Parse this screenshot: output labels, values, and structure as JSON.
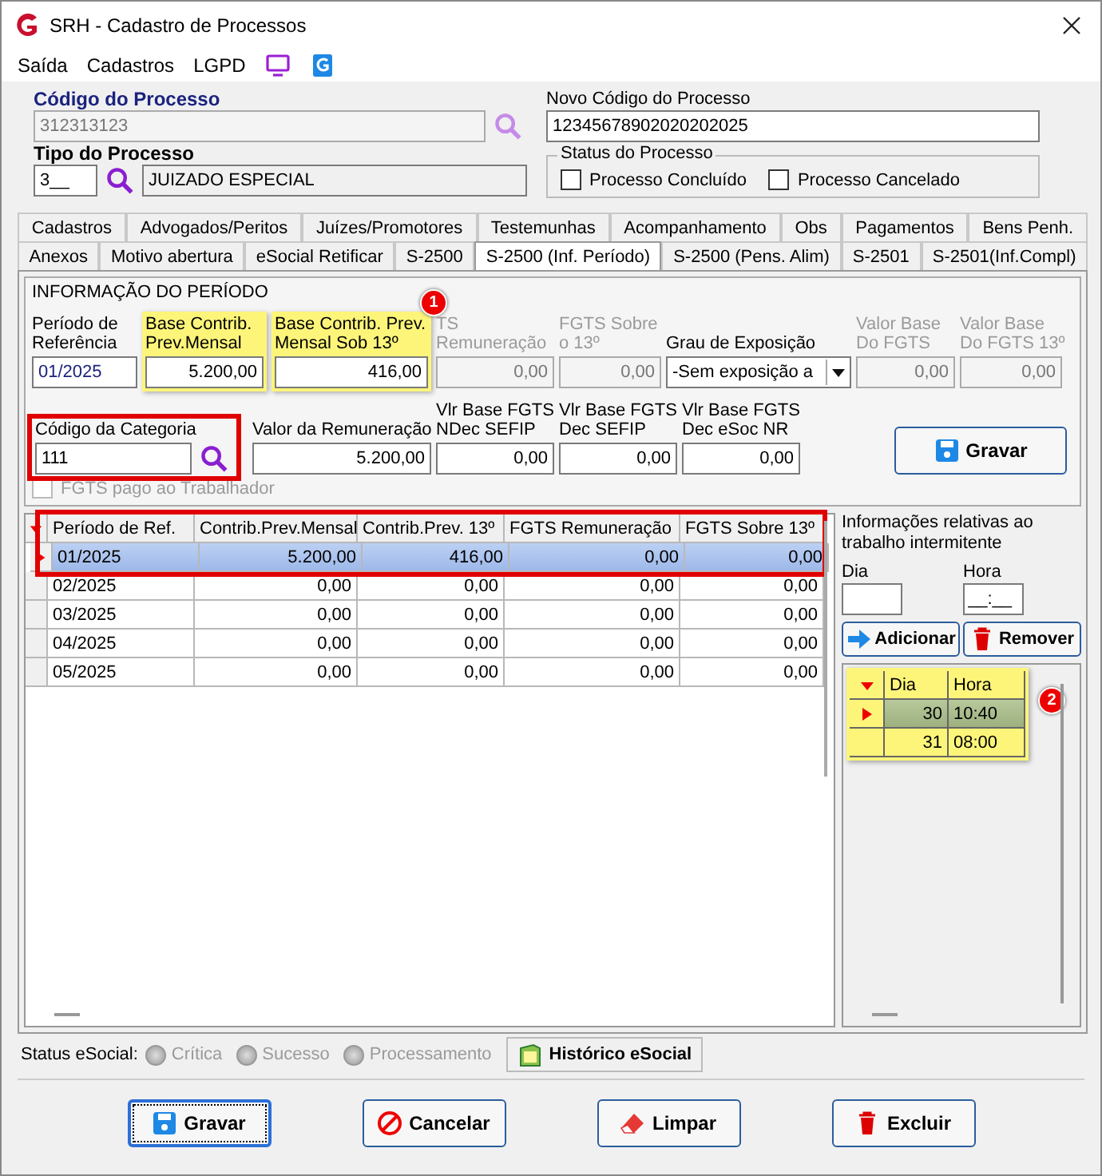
{
  "window": {
    "title": "SRH - Cadastro de Processos"
  },
  "menu": [
    {
      "label": "Saída"
    },
    {
      "label": "Cadastros"
    },
    {
      "label": "LGPD"
    }
  ],
  "process_code": {
    "label": "Código do Processo",
    "value": "312313123",
    "disabled": true
  },
  "new_process_code": {
    "label": "Novo Código do Processo",
    "value": "12345678902020202025"
  },
  "process_type": {
    "label": "Tipo do Processo",
    "code": "3__",
    "description": "JUIZADO ESPECIAL"
  },
  "process_status": {
    "title": "Status do Processo",
    "options": [
      {
        "label": "Processo Concluído",
        "checked": false
      },
      {
        "label": "Processo Cancelado",
        "checked": false
      }
    ]
  },
  "tabs_row_1": [
    {
      "label": "Cadastros",
      "selected": false
    },
    {
      "label": "Advogados/Peritos",
      "selected": false
    },
    {
      "label": "Juízes/Promotores",
      "selected": false
    },
    {
      "label": "Testemunhas",
      "selected": false
    },
    {
      "label": "Acompanhamento",
      "selected": false
    },
    {
      "label": "Obs",
      "selected": false
    },
    {
      "label": "Pagamentos",
      "selected": false
    },
    {
      "label": "Bens Penh.",
      "selected": false
    }
  ],
  "tabs_row_2": [
    {
      "label": "Anexos",
      "selected": false
    },
    {
      "label": "Motivo abertura",
      "selected": false
    },
    {
      "label": "eSocial Retificar",
      "selected": false
    },
    {
      "label": "S-2500",
      "selected": false
    },
    {
      "label": "S-2500 (Inf. Período)",
      "selected": true
    },
    {
      "label": "S-2500 (Pens. Alim)",
      "selected": false
    },
    {
      "label": "S-2501",
      "selected": false
    },
    {
      "label": "S-2501(Inf.Compl)",
      "selected": false
    }
  ],
  "period_info": {
    "title": "INFORMAÇÃO DO PERÍODO",
    "fields_row_1": [
      {
        "label": "Período de\nReferência",
        "value": "01/2025",
        "kind": "text",
        "disabled": false,
        "highlighted": false
      },
      {
        "label": "Base Contrib.\nPrev.Mensal",
        "value": "5.200,00",
        "kind": "text",
        "disabled": false,
        "highlighted": true
      },
      {
        "label": "Base Contrib. Prev.\nMensal Sob 13º",
        "value": "416,00",
        "kind": "text",
        "disabled": false,
        "highlighted": true,
        "badge": "1"
      },
      {
        "label": "TS\nRemuneração",
        "value": "0,00",
        "kind": "text",
        "disabled": true,
        "highlighted": false
      },
      {
        "label": "FGTS Sobre\no 13º",
        "value": "0,00",
        "kind": "text",
        "disabled": true,
        "highlighted": false
      },
      {
        "label": "Grau de Exposição",
        "value": "-Sem exposição a",
        "kind": "select",
        "disabled": false,
        "highlighted": false
      },
      {
        "label": "Valor Base\nDo FGTS",
        "value": "0,00",
        "kind": "text",
        "disabled": true,
        "highlighted": false
      },
      {
        "label": "Valor Base\nDo FGTS 13º",
        "value": "0,00",
        "kind": "text",
        "disabled": true,
        "highlighted": false
      }
    ],
    "fields_row_2": [
      {
        "label": "Código da Categoria",
        "value": "111",
        "kind": "search",
        "outlined": true
      },
      {
        "label": "Valor da Remuneração",
        "value": "5.200,00",
        "kind": "text",
        "outlined": false
      },
      {
        "label": "Vlr Base FGTS\nNDec SEFIP",
        "value": "0,00",
        "kind": "text",
        "outlined": false
      },
      {
        "label": "Vlr Base FGTS\nDec SEFIP",
        "value": "0,00",
        "kind": "text",
        "outlined": false
      },
      {
        "label": "Vlr Base FGTS\nDec eSoc NR",
        "value": "0,00",
        "kind": "text",
        "outlined": false
      }
    ],
    "save_button": {
      "label": "Gravar"
    },
    "fgts_paid": {
      "label": "FGTS pago ao Trabalhador",
      "checked": false,
      "disabled": true
    }
  },
  "periods_table": {
    "outlined": true,
    "columns": [
      "Período de Ref.",
      "Contrib.Prev.Mensal",
      "Contrib.Prev. 13º",
      "FGTS Remuneração",
      "FGTS Sobre 13º"
    ],
    "rows": [
      {
        "cells": [
          "01/2025",
          "5.200,00",
          "416,00",
          "0,00",
          "0,00"
        ],
        "selected": true
      },
      {
        "cells": [
          "02/2025",
          "0,00",
          "0,00",
          "0,00",
          "0,00"
        ],
        "selected": false
      },
      {
        "cells": [
          "03/2025",
          "0,00",
          "0,00",
          "0,00",
          "0,00"
        ],
        "selected": false
      },
      {
        "cells": [
          "04/2025",
          "0,00",
          "0,00",
          "0,00",
          "0,00"
        ],
        "selected": false
      },
      {
        "cells": [
          "05/2025",
          "0,00",
          "0,00",
          "0,00",
          "0,00"
        ],
        "selected": false
      }
    ]
  },
  "intermittent": {
    "title": "Informações relativas ao trabalho intermitente",
    "day": {
      "label": "Dia"
    },
    "hour": {
      "label": "Hora",
      "value": "__:__"
    },
    "buttons": [
      {
        "label": "Adicionar",
        "kind": "add"
      },
      {
        "label": "Remover",
        "kind": "remove"
      }
    ],
    "table": {
      "highlighted": true,
      "badge": "2",
      "columns": [
        "Dia",
        "Hora"
      ],
      "rows": [
        {
          "day": "30",
          "hour": "10:40",
          "selected": true
        },
        {
          "day": "31",
          "hour": "08:00",
          "selected": false
        }
      ]
    }
  },
  "status_bar": {
    "label": "Status eSocial:",
    "options": [
      {
        "label": "Crítica",
        "selected": false
      },
      {
        "label": "Sucesso",
        "selected": false
      },
      {
        "label": "Processamento",
        "selected": false
      }
    ],
    "history_button": {
      "label": "Histórico eSocial"
    }
  },
  "buttons": [
    {
      "label": "Gravar",
      "kind": "save",
      "focused": true
    },
    {
      "label": "Cancelar",
      "kind": "cancel",
      "focused": false
    },
    {
      "label": "Limpar",
      "kind": "clear",
      "focused": false
    },
    {
      "label": "Excluir",
      "kind": "delete",
      "focused": false
    }
  ]
}
